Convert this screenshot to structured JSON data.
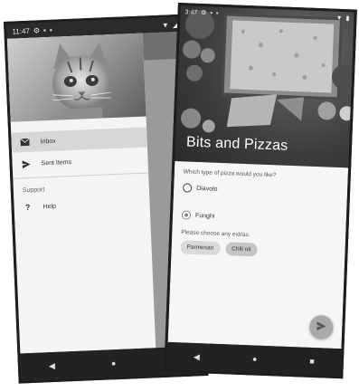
{
  "left_phone": {
    "status": {
      "time": "11:47",
      "icons_left": [
        "gear-icon",
        "sd-card-icon",
        "android-icon"
      ],
      "icons_right": [
        "wifi-icon",
        "signal-icon",
        "battery-icon"
      ]
    },
    "drawer": {
      "items": [
        {
          "label": "Inbox",
          "icon": "mail-icon",
          "selected": true
        },
        {
          "label": "Sent Items",
          "icon": "send-icon",
          "selected": false
        }
      ],
      "section_label": "Support",
      "support_items": [
        {
          "label": "Help",
          "icon": "help-icon"
        }
      ]
    },
    "appbar": {
      "overflow_glyph": "?"
    }
  },
  "right_phone": {
    "status": {
      "time": "3:47",
      "icons_left": [
        "gear-icon",
        "sd-card-icon",
        "android-icon"
      ],
      "icons_right": [
        "wifi-icon",
        "battery-icon"
      ]
    },
    "hero_title": "Bits and Pizzas",
    "question": "Which type of pizza would you like?",
    "options": [
      {
        "label": "Diavolo",
        "checked": false
      },
      {
        "label": "Funghi",
        "checked": true
      }
    ],
    "extras_label": "Please choose any extras:",
    "chips": [
      "Parmesan",
      "Chili oil"
    ],
    "fab_icon": "send-icon"
  },
  "navbar": {
    "back_glyph": "◀",
    "home_glyph": "●",
    "recents_glyph": "■"
  },
  "colors": {
    "drawer_bg": "#f4f4f4",
    "selected_bg": "#d7d7d7",
    "screen_bg": "#f6f6f6",
    "nav_bg": "#222222"
  }
}
